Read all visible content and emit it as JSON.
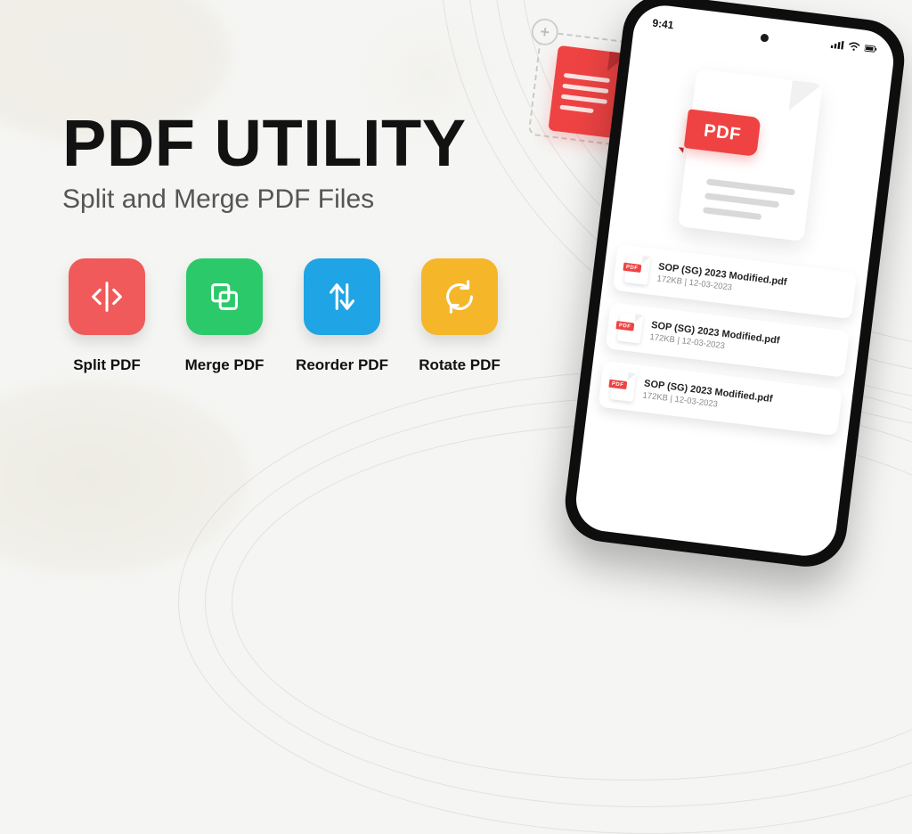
{
  "hero": {
    "title": "PDF UTILITY",
    "subtitle": "Split and Merge PDF Files"
  },
  "features": [
    {
      "label": "Split PDF",
      "color": "#f05a5a"
    },
    {
      "label": "Merge PDF",
      "color": "#2bc96a"
    },
    {
      "label": "Reorder PDF",
      "color": "#1fa4e6"
    },
    {
      "label": "Rotate PDF",
      "color": "#f5b62a"
    }
  ],
  "phone": {
    "time": "9:41",
    "badge_label": "PDF",
    "files": [
      {
        "name": "SOP (SG) 2023 Modified.pdf",
        "size": "172KB",
        "date": "12-03-2023",
        "pdf_tag": "PDF"
      },
      {
        "name": "SOP (SG) 2023 Modified.pdf",
        "size": "172KB",
        "date": "12-03-2023",
        "pdf_tag": "PDF"
      },
      {
        "name": "SOP (SG) 2023 Modified.pdf",
        "size": "172KB",
        "date": "12-03-2023",
        "pdf_tag": "PDF"
      }
    ]
  },
  "dropzone": {
    "plus": "+"
  }
}
